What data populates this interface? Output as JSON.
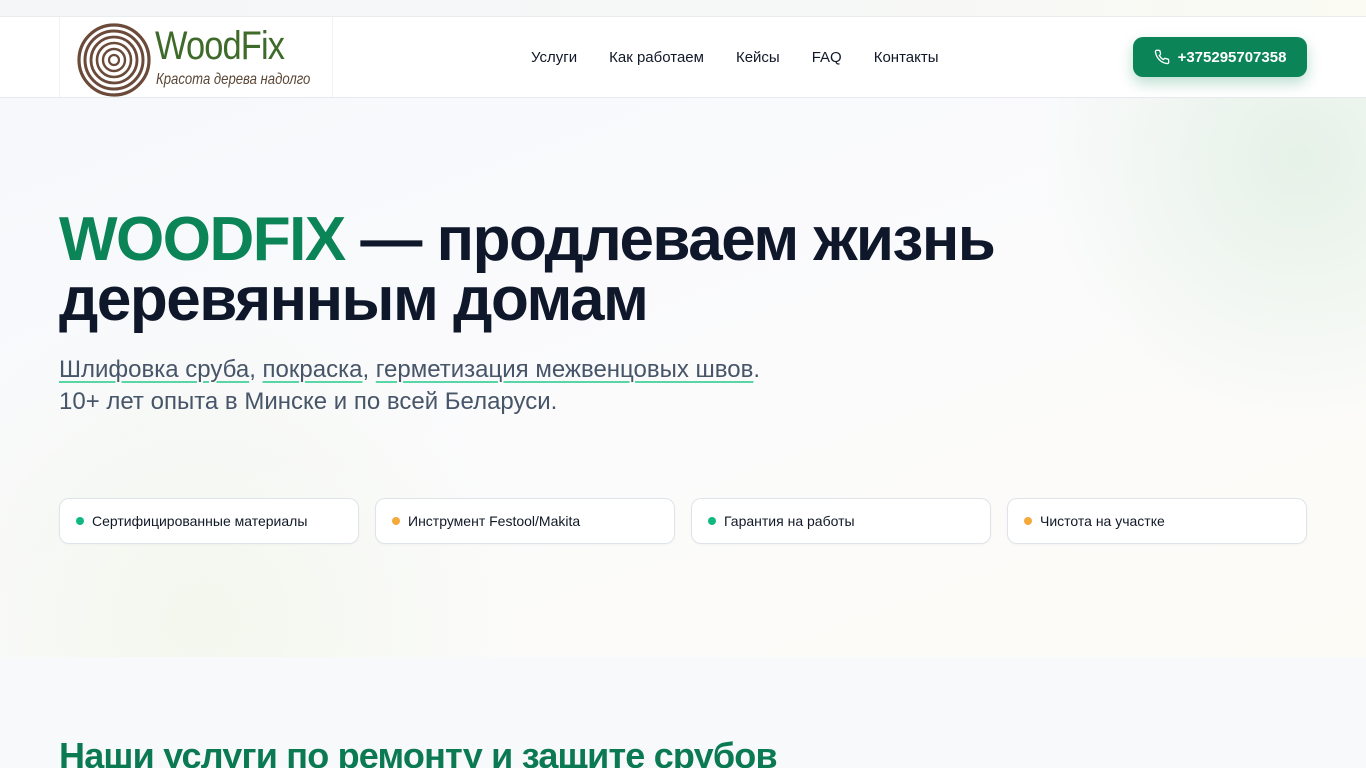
{
  "logo": {
    "name": "WoodFix",
    "tagline": "Красота дерева надолго"
  },
  "nav": {
    "items": [
      {
        "label": "Услуги"
      },
      {
        "label": "Как работаем"
      },
      {
        "label": "Кейсы"
      },
      {
        "label": "FAQ"
      },
      {
        "label": "Контакты"
      }
    ]
  },
  "header": {
    "phone": "+375295707358"
  },
  "hero": {
    "title_brand": "WOODFIX",
    "title_rest": " — продлеваем жизнь деревянным домам",
    "sub_link1": "Шлифовка сруба",
    "sub_sep1": ", ",
    "sub_link2": "покраска",
    "sub_sep2": ", ",
    "sub_link3": "герметизация межвенцовых швов",
    "sub_end": ".",
    "sub_line2": "10+ лет опыта в Минске и по всей Беларуси."
  },
  "features": [
    {
      "label": "Сертифицированные материалы",
      "dot_color": "#10b981"
    },
    {
      "label": "Инструмент Festool/Makita",
      "dot_color": "#f5a93b"
    },
    {
      "label": "Гарантия на работы",
      "dot_color": "#10b981"
    },
    {
      "label": "Чистота на участке",
      "dot_color": "#f5a93b"
    }
  ],
  "services": {
    "title": "Наши услуги по ремонту и защите срубов"
  },
  "colors": {
    "brand_green": "#0b8457",
    "heading_dark": "#0f172a",
    "text_muted": "#475569"
  }
}
